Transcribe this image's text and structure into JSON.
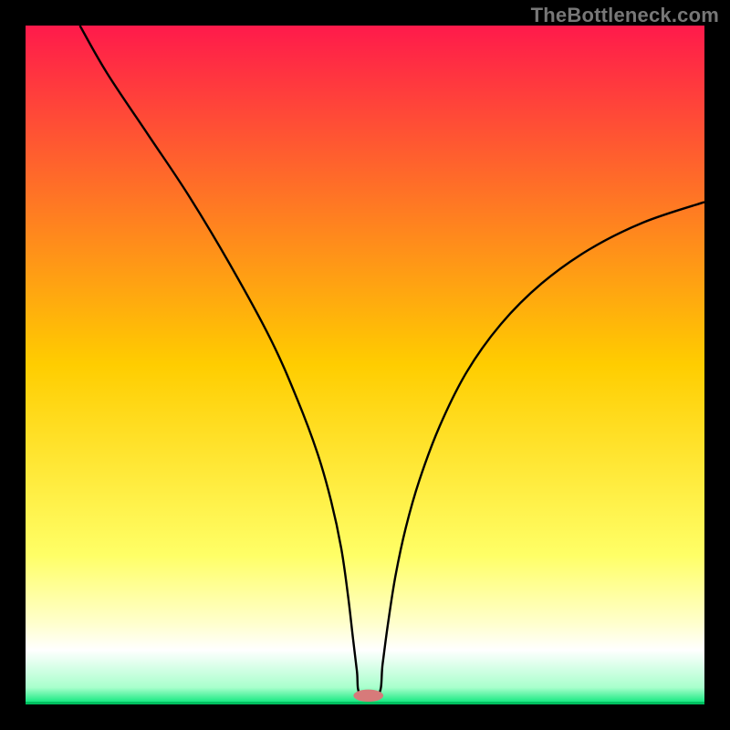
{
  "watermark": "TheBottleneck.com",
  "chart_data": {
    "type": "line",
    "title": "",
    "xlabel": "",
    "ylabel": "",
    "xlim": [
      0,
      100
    ],
    "ylim": [
      0,
      100
    ],
    "grid": false,
    "legend": false,
    "background_gradient": {
      "stops": [
        {
          "offset": 0.0,
          "color": "#ff1a4b"
        },
        {
          "offset": 0.5,
          "color": "#ffcd00"
        },
        {
          "offset": 0.78,
          "color": "#ffff66"
        },
        {
          "offset": 0.88,
          "color": "#ffffcc"
        },
        {
          "offset": 0.92,
          "color": "#ffffff"
        },
        {
          "offset": 0.975,
          "color": "#a8ffcc"
        },
        {
          "offset": 1.0,
          "color": "#00e676"
        }
      ]
    },
    "series": [
      {
        "name": "bottleneck-curve",
        "color": "#000000",
        "x": [
          8,
          12,
          18,
          24,
          30,
          36,
          40,
          43,
          45,
          46.5,
          47.5,
          48.2,
          48.8,
          49.3,
          52.0,
          52.6,
          53.4,
          54.5,
          56,
          58,
          61,
          65,
          70,
          76,
          83,
          91,
          100
        ],
        "y": [
          100,
          93,
          84,
          75,
          65,
          54,
          45,
          37,
          30,
          23,
          16,
          10,
          5,
          1.5,
          1.5,
          6,
          12,
          19,
          26,
          33,
          41,
          49,
          56,
          62,
          67,
          71,
          74
        ]
      }
    ],
    "marker": {
      "name": "optimal-point",
      "shape": "capsule",
      "color": "#d77a7a",
      "cx": 50.5,
      "cy": 1.3,
      "rx": 2.2,
      "ry": 0.9
    },
    "baseline": {
      "y": 0.2,
      "color": "#00c060"
    }
  }
}
